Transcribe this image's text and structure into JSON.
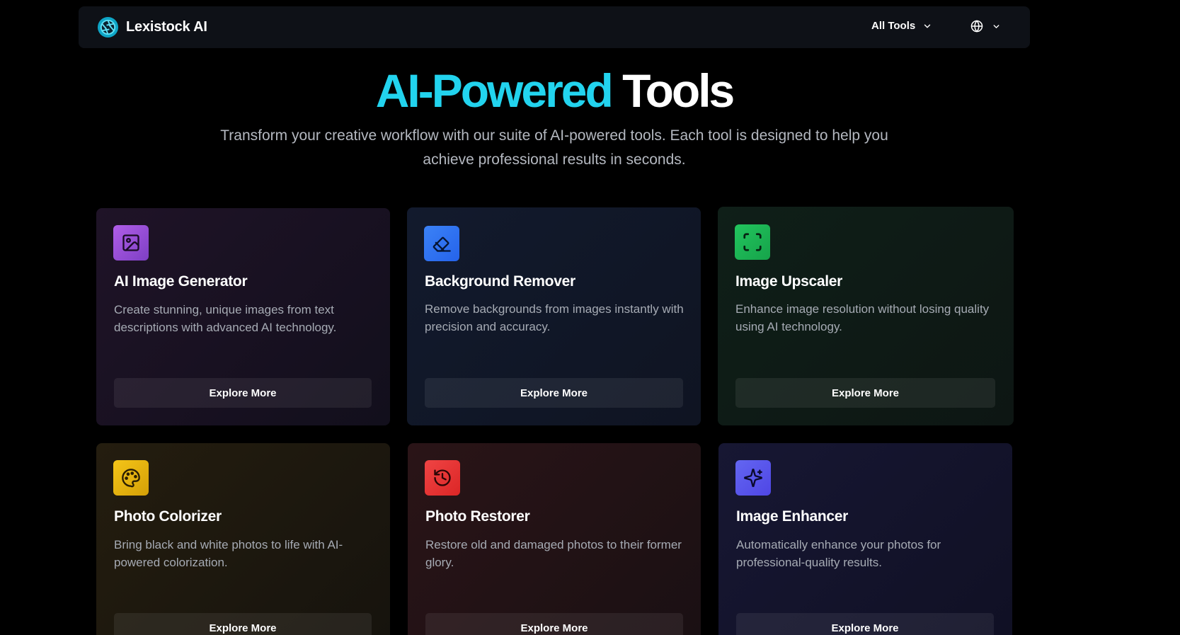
{
  "header": {
    "brand": "Lexistock AI",
    "tools_menu_label": "All Tools",
    "language_icon": "globe-icon"
  },
  "hero": {
    "title_accent": "AI-Powered",
    "title_rest": "Tools",
    "subtitle": "Transform your creative workflow with our suite of AI-powered tools. Each tool is designed to help you achieve professional results in seconds."
  },
  "tools": [
    {
      "icon": "image-icon",
      "title": "AI Image Generator",
      "description": "Create stunning, unique images from text descriptions with advanced AI technology.",
      "button_label": "Explore More",
      "accent": "#a855f7"
    },
    {
      "icon": "eraser-icon",
      "title": "Background Remover",
      "description": "Remove backgrounds from images instantly with precision and accuracy.",
      "button_label": "Explore More",
      "accent": "#3b82f6"
    },
    {
      "icon": "expand-icon",
      "title": "Image Upscaler",
      "description": "Enhance image resolution without losing quality using AI technology.",
      "button_label": "Explore More",
      "accent": "#22c55e"
    },
    {
      "icon": "palette-icon",
      "title": "Photo Colorizer",
      "description": "Bring black and white photos to life with AI-powered colorization.",
      "button_label": "Explore More",
      "accent": "#eab308"
    },
    {
      "icon": "history-icon",
      "title": "Photo Restorer",
      "description": "Restore old and damaged photos to their former glory.",
      "button_label": "Explore More",
      "accent": "#ef4444"
    },
    {
      "icon": "sparkles-icon",
      "title": "Image Enhancer",
      "description": "Automatically enhance your photos for professional-quality results.",
      "button_label": "Explore More",
      "accent": "#6366f1"
    }
  ]
}
